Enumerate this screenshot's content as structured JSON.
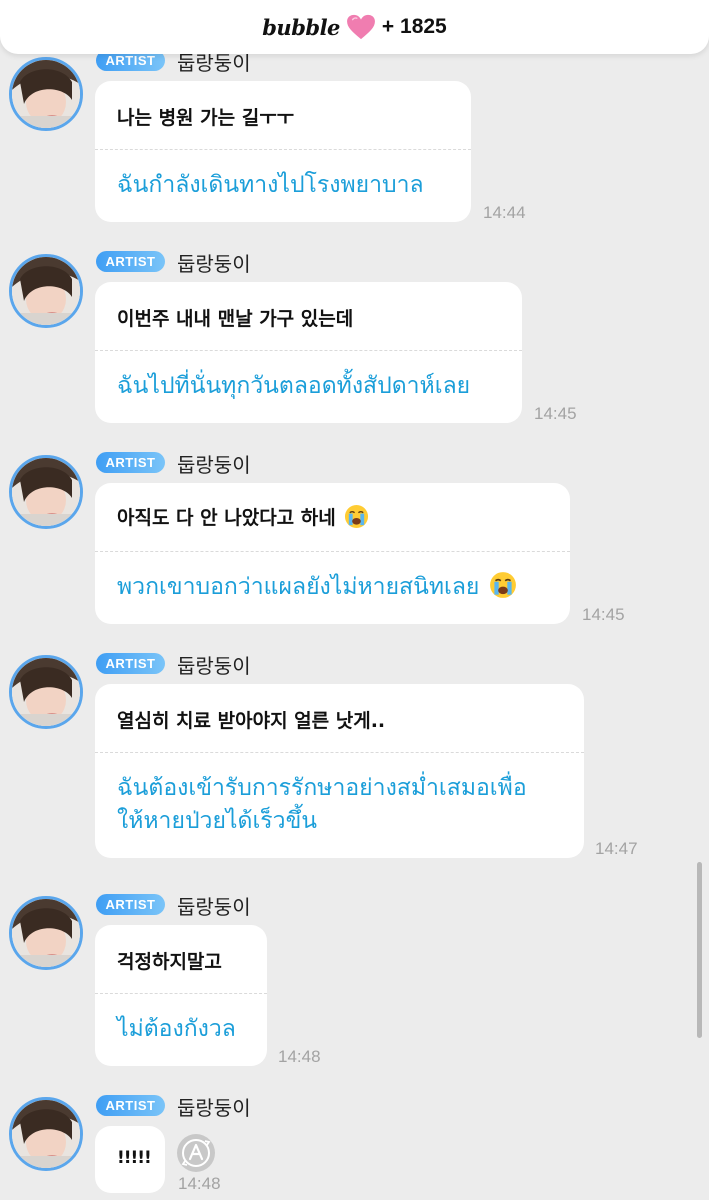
{
  "header": {
    "brand": "bubble",
    "heart_icon": "pink-heart-icon",
    "plus_count": "+ 1825"
  },
  "colors": {
    "background": "#ececec",
    "bubble": "#ffffff",
    "translation_text": "#1b9ed9",
    "badge_start": "#3f9ef4",
    "badge_end": "#7ac4f8",
    "avatar_ring": "#5aa6ec",
    "timestamp": "#a3a3a3",
    "heart": "#f07db0"
  },
  "badge_label": "ARTIST",
  "sender_name": "둡랑둥이",
  "messages": [
    {
      "original": "나는 병원 가는 길ㅜㅜ",
      "translation": "ฉันกำลังเดินทางไปโรงพยาบาล",
      "time": "14:44"
    },
    {
      "original": "이번주 내내 맨날 가구 있는데",
      "translation": "ฉันไปที่นั่นทุกวันตลอดทั้งสัปดาห์เลย",
      "time": "14:45"
    },
    {
      "original": "아직도 다 안 나았다고 하네",
      "translation": "พวกเขาบอกว่าแผลยังไม่หายสนิทเลย",
      "time": "14:45",
      "emoji": "crying-face-icon"
    },
    {
      "original": "열심히 치료 받아야지 얼른 낫게..",
      "translation_line1": "ฉันต้องเข้ารับการรักษาอย่างสม่ำเสมอเพื่อ",
      "translation_line2": "ให้หายป่วยได้เร็วขึ้น",
      "time": "14:47"
    },
    {
      "original": "걱정하지말고",
      "translation": "ไม่ต้องกังวล",
      "time": "14:48"
    },
    {
      "original": "!!!!!",
      "time": "14:48",
      "translate_icon": "translate-a-icon"
    }
  ]
}
